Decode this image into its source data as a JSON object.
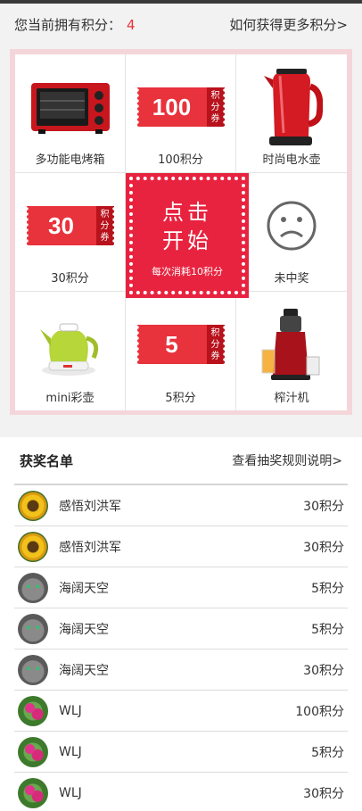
{
  "header": {
    "points_label": "您当前拥有积分：",
    "points_value": "4",
    "more_link": "如何获得更多积分>"
  },
  "prizes": [
    {
      "label": "多功能电烤箱",
      "icon": "oven-icon"
    },
    {
      "label": "100积分",
      "icon": "coupon-icon",
      "amount": "100"
    },
    {
      "label": "时尚电水壶",
      "icon": "kettle-icon"
    },
    {
      "label": "30积分",
      "icon": "coupon-icon",
      "amount": "30"
    },
    {
      "label": "未中奖",
      "icon": "sad-face-icon"
    },
    {
      "label": "mini彩壶",
      "icon": "mini-kettle-icon"
    },
    {
      "label": "5积分",
      "icon": "coupon-icon",
      "amount": "5"
    },
    {
      "label": "榨汁机",
      "icon": "juicer-icon"
    }
  ],
  "coupon_tag": [
    "积",
    "分",
    "券"
  ],
  "start": {
    "line1": "点击",
    "line2": "开始",
    "cost": "每次消耗10积分"
  },
  "winners": {
    "title": "获奖名单",
    "rules_link": "查看抽奖规则说明>",
    "rows": [
      {
        "name": "感悟刘洪军",
        "points": "30积分",
        "avatar": "sunflower"
      },
      {
        "name": "感悟刘洪军",
        "points": "30积分",
        "avatar": "sunflower"
      },
      {
        "name": "海阔天空",
        "points": "5积分",
        "avatar": "cat"
      },
      {
        "name": "海阔天空",
        "points": "5积分",
        "avatar": "cat"
      },
      {
        "name": "海阔天空",
        "points": "30积分",
        "avatar": "cat"
      },
      {
        "name": "WLJ",
        "points": "100积分",
        "avatar": "flower"
      },
      {
        "name": "WLJ",
        "points": "5积分",
        "avatar": "flower"
      },
      {
        "name": "WLJ",
        "points": "30积分",
        "avatar": "flower"
      }
    ]
  },
  "colors": {
    "accent": "#e8323c",
    "start_bg": "#e8233f",
    "frame": "#f4d6da"
  }
}
